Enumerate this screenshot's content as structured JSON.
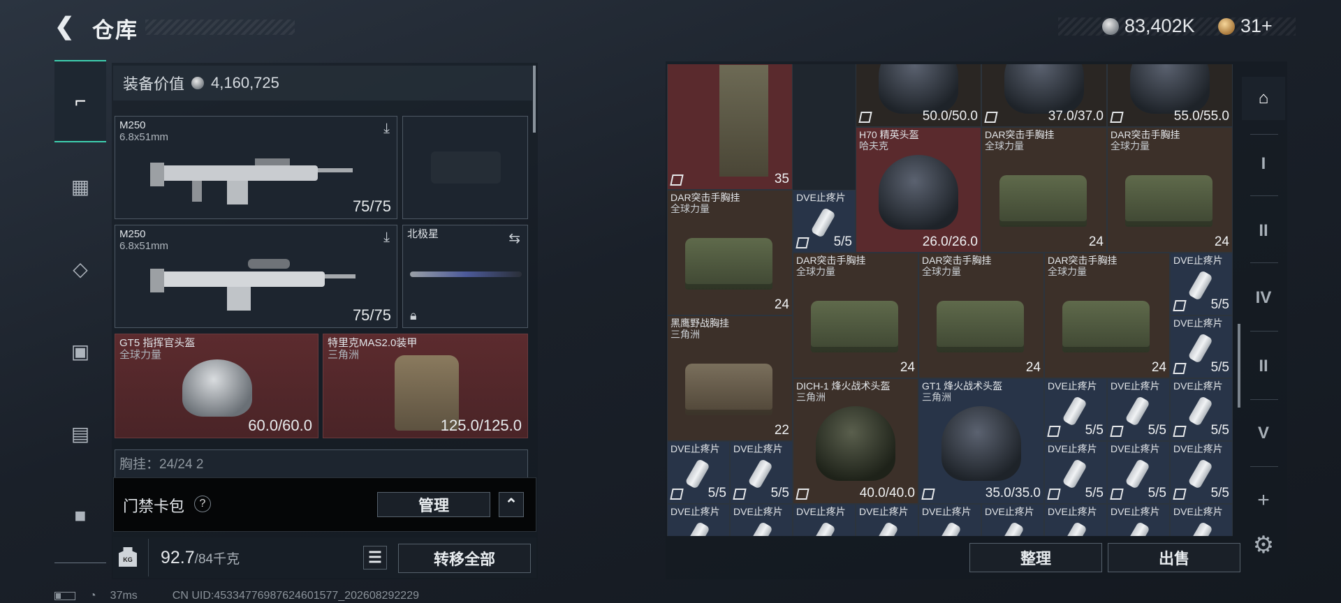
{
  "header": {
    "back_icon": "back-arrow-icon",
    "title": "仓库",
    "silver": "83,402K",
    "gold": "31+"
  },
  "left": {
    "equip_value_label": "装备价值",
    "equip_value": "4,160,725",
    "slots": [
      {
        "name": "M250",
        "sub": "6.8x51mm",
        "value": "75/75"
      },
      {
        "name": "M250",
        "sub": "6.8x51mm",
        "value": "75/75"
      },
      {
        "name": "北极星"
      },
      {
        "name": "GT5 指挥官头盔",
        "sub": "全球力量",
        "value": "60.0/60.0"
      },
      {
        "name": "特里克MAS2.0装甲",
        "sub": "三角洲",
        "value": "125.0/125.0"
      }
    ],
    "partial_label": "胸挂：24/24  2",
    "card_pack_label": "门禁卡包",
    "card_pack_help": "?",
    "manage_label": "管理",
    "weight_value": "92.7",
    "weight_max": "/84千克",
    "kg_label": "KG",
    "transfer_label": "转移全部"
  },
  "status": {
    "ping": "37ms",
    "uid": "CN UID:45334776987624601577_202608292229"
  },
  "grid": {
    "items": [
      {
        "v": "35"
      },
      {
        "v": "50.0/50.0"
      },
      {
        "v": "37.0/37.0"
      },
      {
        "v": "55.0/55.0"
      },
      {
        "n": "H70 精英头盔",
        "s": "哈夫克",
        "v": "26.0/26.0"
      },
      {
        "n": "DAR突击手胸挂",
        "s": "全球力量",
        "v": "24"
      },
      {
        "n": "DAR突击手胸挂",
        "s": "全球力量",
        "v": "24"
      },
      {
        "n": "DAR突击手胸挂",
        "s": "全球力量",
        "v": "24"
      },
      {
        "n": "DVE止疼片",
        "v": "5/5"
      },
      {
        "n": "DAR突击手胸挂",
        "s": "全球力量",
        "v": "24"
      },
      {
        "n": "DAR突击手胸挂",
        "s": "全球力量",
        "v": "24"
      },
      {
        "n": "DAR突击手胸挂",
        "s": "全球力量",
        "v": "24"
      },
      {
        "n": "DVE止疼片",
        "v": "5/5"
      },
      {
        "n": "黑鹰野战胸挂",
        "s": "三角洲",
        "v": "22"
      },
      {
        "n": "DVE止疼片",
        "v": "5/5"
      },
      {
        "n": "DICH-1 烽火战术头盔",
        "s": "三角洲",
        "v": "40.0/40.0"
      },
      {
        "n": "GT1 烽火战术头盔",
        "s": "三角洲",
        "v": "35.0/35.0"
      },
      {
        "n": "DVE止疼片",
        "v": "5/5"
      },
      {
        "n": "DVE止疼片",
        "v": "5/5"
      },
      {
        "n": "DVE止疼片",
        "v": "5/5"
      },
      {
        "n": "DVE止疼片",
        "v": "5/5"
      },
      {
        "n": "DVE止疼片",
        "v": "5/5"
      },
      {
        "n": "DVE止疼片",
        "v": "5/5"
      },
      {
        "n": "DVE止疼片",
        "v": "5/5"
      },
      {
        "n": "DVE止疼片",
        "v": "5/5"
      },
      {
        "n": "DVE止疼片"
      },
      {
        "n": "DVE止疼片"
      },
      {
        "n": "DVE止疼片"
      },
      {
        "n": "DVE止疼片"
      },
      {
        "n": "DVE止疼片"
      },
      {
        "n": "DVE止疼片"
      },
      {
        "n": "DVE止疼片"
      },
      {
        "n": "DVE止疼片"
      },
      {
        "n": "DVE止疼片"
      },
      {
        "n": "DVE止疼片"
      }
    ],
    "sort_label": "整理",
    "sell_label": "出售"
  },
  "right_tabs": [
    "I",
    "II",
    "IV",
    "II",
    "V",
    "+"
  ]
}
